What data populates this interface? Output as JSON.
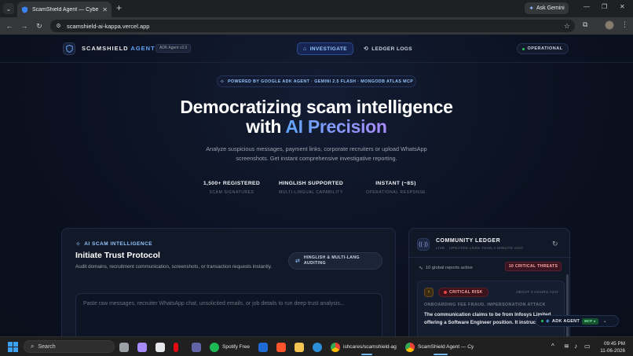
{
  "browser": {
    "tab_title": "ScamShield Agent — Cyber Fra",
    "new_tab": "+",
    "ask_gemini": "Ask Gemini",
    "url": "scamshield-ai-kappa.vercel.app"
  },
  "header": {
    "brand_prefix": "SCAMSHIELD",
    "brand_accent": "AGENT",
    "version": "ADK Agent v2.0",
    "nav": [
      {
        "label": "INVESTIGATE",
        "active": true
      },
      {
        "label": "LEDGER LOGS",
        "active": false
      }
    ],
    "status": "OPERATIONAL"
  },
  "hero": {
    "powered_by": "POWERED BY GOOGLE ADK AGENT · GEMINI 2.5 FLASH · MONGODB ATLAS MCP",
    "title_line1": "Democratizing scam intelligence",
    "title_line2_prefix": "with",
    "title_line2_accent": "AI Precision",
    "subtitle": "Analyze suspicious messages, payment links, corporate recruiters or upload WhatsApp screenshots. Get instant comprehensive investigative reporting.",
    "stats": [
      {
        "value": "1,500+ REGISTERED",
        "label": "SCAM SIGNATURES"
      },
      {
        "value": "HINGLISH SUPPORTED",
        "label": "MULTI-LINGUAL CAPABILITY"
      },
      {
        "value": "INSTANT (~8S)",
        "label": "OPERATIONAL RESPONSE"
      }
    ]
  },
  "investigate": {
    "section_label": "AI SCAM INTELLIGENCE",
    "title": "Initiate Trust Protocol",
    "description": "Audit domains, recruitment communication, screenshots, or transaction requests instantly.",
    "badge": "HINGLISH & MULTI-LANG AUDITING",
    "input_placeholder": "Paste raw messages, recruiter WhatsApp chat, unsolicited emails, or job details to run deep trust analysis..."
  },
  "ledger": {
    "title": "COMMUNITY LEDGER",
    "subtitle": "LIVE · UPDATED LESS THAN A MINUTE AGO",
    "active_reports": "10 global reports active",
    "critical_badge": "10 CRITICAL THREATS",
    "card": {
      "risk": "CRITICAL RISK",
      "time": "ABOUT 3 HOURS AGO",
      "category": "ONBOARDING FEE FRAUD, IMPERSONATION ATTACK",
      "text": "The communication claims to be from Infosys Limited offering a Software Engineer position. It instruc"
    }
  },
  "adk_widget": {
    "label": "ADK AGENT",
    "badge": "MCP ●"
  },
  "taskbar": {
    "search": "Search",
    "spotify": "Spotify Free",
    "chrome1": "ishcares/scamshield-ag",
    "chrome2": "ScamShield Agent — Cy",
    "time": "09:45 PM",
    "date": "11-06-2026"
  },
  "colors": {
    "accent_blue": "#60a5fa",
    "accent_purple": "#a78bfa",
    "critical_red": "#ef4444",
    "operational_green": "#22c55e"
  }
}
